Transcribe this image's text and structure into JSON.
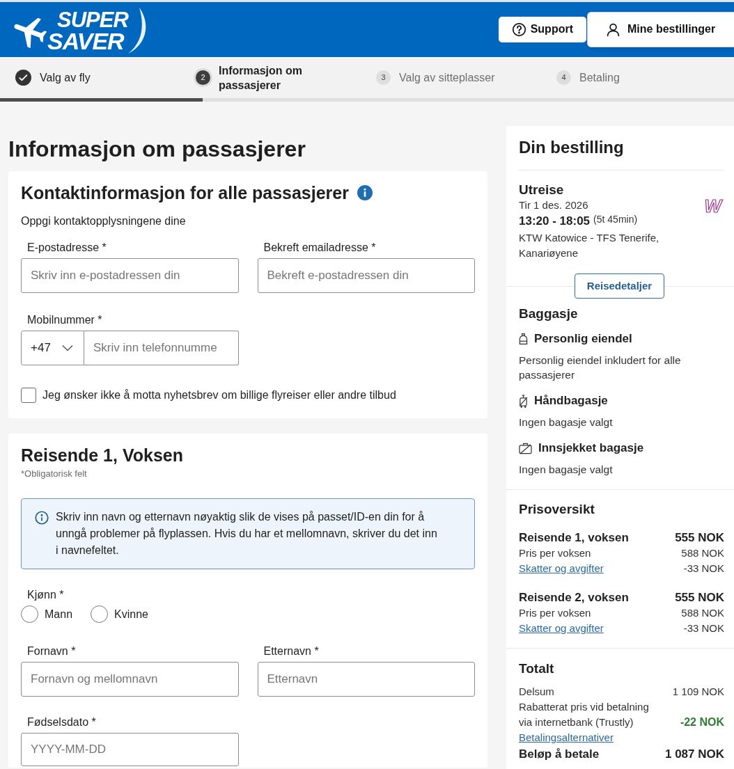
{
  "header": {
    "logo": {
      "line_1": "SUPER",
      "line_2": "SAVER"
    },
    "buttons": [
      {
        "kind": "help",
        "label": "Support"
      },
      {
        "kind": "account",
        "label": "Mine bestillinger"
      }
    ]
  },
  "steps": [
    {
      "label": "Valg av fly",
      "completed": true,
      "selected": false
    },
    {
      "number": "2",
      "label": "Informasjon om passasjerer",
      "completed": false,
      "selected": true
    },
    {
      "number": "3",
      "label": "Valg av sitteplasser",
      "completed": false,
      "selected": false
    },
    {
      "number": "4",
      "label": "Betaling",
      "completed": false,
      "selected": false
    }
  ],
  "progress": {
    "level": 0.276
  },
  "page_title": "Informasjon om passasjerer",
  "contact": {
    "title": "Kontaktinformasjon for alle passasjerer",
    "subtitle": "Oppgi kontaktopplysningene dine",
    "fields": [
      {
        "label": "E-postadresse *",
        "placeholder": "Skriv inn e-postadressen din"
      },
      {
        "label": "Bekreft emailadresse *",
        "placeholder": "Bekreft e-postadressen din"
      }
    ],
    "phone": {
      "label": "Mobilnummer *",
      "country_code": "+47",
      "placeholder": "Skriv inn telefonnumme"
    },
    "newsletter": {
      "label": "Jeg ønsker ikke å motta nyhetsbrev om billige flyreiser eller andre tilbud",
      "checked": false
    }
  },
  "traveler": {
    "title": "Reisende 1, Voksen",
    "note": "*Obligatorisk felt",
    "notice": "Skriv inn navn og etternavn nøyaktig slik de vises på passet/ID-en din for å unngå problemer på flyplassen. Hvis du har et mellomnavn, skriver du det inn i navnefeltet.",
    "gender": {
      "label": "Kjønn *",
      "options": [
        {
          "label": "Mann",
          "selected": false
        },
        {
          "label": "Kvinne",
          "selected": false
        }
      ]
    },
    "name_fields": [
      {
        "label": "Fornavn *",
        "placeholder": "Fornavn og mellomnavn"
      },
      {
        "label": "Etternavn *",
        "placeholder": "Etternavn"
      }
    ],
    "birth_date": {
      "label": "Fødselsdato *",
      "placeholder": "YYYY-MM-DD"
    }
  },
  "summary": {
    "title": "Din bestilling",
    "outbound": {
      "heading": "Utreise",
      "date": "Tir 1 des. 2026",
      "times": "13:20 - 18:05",
      "duration": "(5t 45min)",
      "route": "KTW Katowice - TFS Tenerife, Kanariøyene",
      "airline_logo": "W"
    },
    "details_button": "Reisedetaljer",
    "baggage": {
      "title": "Baggasje",
      "items": [
        {
          "kind": "personal",
          "title": "Personlig eiendel",
          "description": "Personlig eiendel inkludert for alle passasjerer"
        },
        {
          "kind": "cabin",
          "title": "Håndbagasje",
          "description": "Ingen bagasje valgt"
        },
        {
          "kind": "checked",
          "title": "Innsjekket bagasje",
          "description": "Ingen bagasje valgt"
        }
      ]
    },
    "prices": {
      "title": "Prisoversikt",
      "travelers": [
        {
          "name": "Reisende 1, voksen",
          "total": "555 NOK",
          "lines": [
            {
              "label": "Pris per voksen",
              "amount": "588 NOK",
              "link": false
            },
            {
              "label": "Skatter og avgifter",
              "amount": "-33 NOK",
              "link": true
            }
          ]
        },
        {
          "name": "Reisende 2, voksen",
          "total": "555 NOK",
          "lines": [
            {
              "label": "Pris per voksen",
              "amount": "588 NOK",
              "link": false
            },
            {
              "label": "Skatter og avgifter",
              "amount": "-33 NOK",
              "link": true
            }
          ]
        }
      ]
    },
    "total": {
      "title": "Totalt",
      "lines": [
        {
          "kind": "subtotal",
          "label": "Delsum",
          "amount": "1 109 NOK"
        },
        {
          "kind": "discount",
          "label": "Rabatterat pris vid betalning via internetbank (Trustly)",
          "amount": "-22 NOK"
        },
        {
          "kind": "link",
          "label": "Betalingsalternativer"
        },
        {
          "kind": "grand",
          "label": "Beløp å betale",
          "amount": "1 087 NOK"
        }
      ]
    }
  }
}
